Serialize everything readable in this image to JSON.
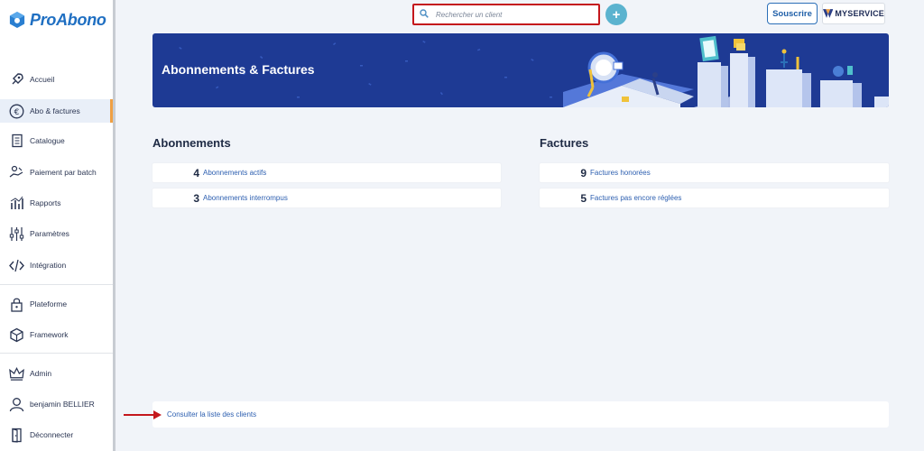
{
  "brand": {
    "name": "ProAbono",
    "color": "#1f6fc2"
  },
  "sidebar": {
    "items": [
      {
        "label": "Accueil",
        "icon": "rocket-icon"
      },
      {
        "label": "Abo & factures",
        "icon": "euro-icon",
        "active": true
      },
      {
        "label": "Catalogue",
        "icon": "catalog-icon"
      },
      {
        "label": "Paiement par batch",
        "icon": "hand-coins-icon"
      },
      {
        "label": "Rapports",
        "icon": "bar-chart-icon"
      },
      {
        "label": "Paramètres",
        "icon": "sliders-icon"
      },
      {
        "label": "Intégration",
        "icon": "code-icon"
      },
      {
        "label": "Plateforme",
        "icon": "lock-icon"
      },
      {
        "label": "Framework",
        "icon": "cube-icon"
      },
      {
        "label": "Admin",
        "icon": "crown-icon"
      },
      {
        "label": "benjamin BELLIER",
        "icon": "user-icon"
      },
      {
        "label": "Déconnecter",
        "icon": "logout-icon"
      }
    ]
  },
  "topbar": {
    "search_placeholder": "Rechercher un client",
    "add_label": "+",
    "subscribe_label": "Souscrire",
    "service_logo_text": "MYSERVICE"
  },
  "banner": {
    "title": "Abonnements & Factures",
    "color": "#1e3a94"
  },
  "subscriptions": {
    "title": "Abonnements",
    "rows": [
      {
        "count": "4",
        "label": "Abonnements actifs"
      },
      {
        "count": "3",
        "label": "Abonnements interrompus"
      }
    ]
  },
  "invoices": {
    "title": "Factures",
    "rows": [
      {
        "count": "9",
        "label": "Factures honorées"
      },
      {
        "count": "5",
        "label": "Factures pas encore réglées"
      }
    ]
  },
  "footer": {
    "link_label": "Consulter la liste des clients"
  },
  "colors": {
    "accent": "#2d5fb0",
    "highlight": "#c4171c",
    "active_marker": "#f0a043"
  }
}
